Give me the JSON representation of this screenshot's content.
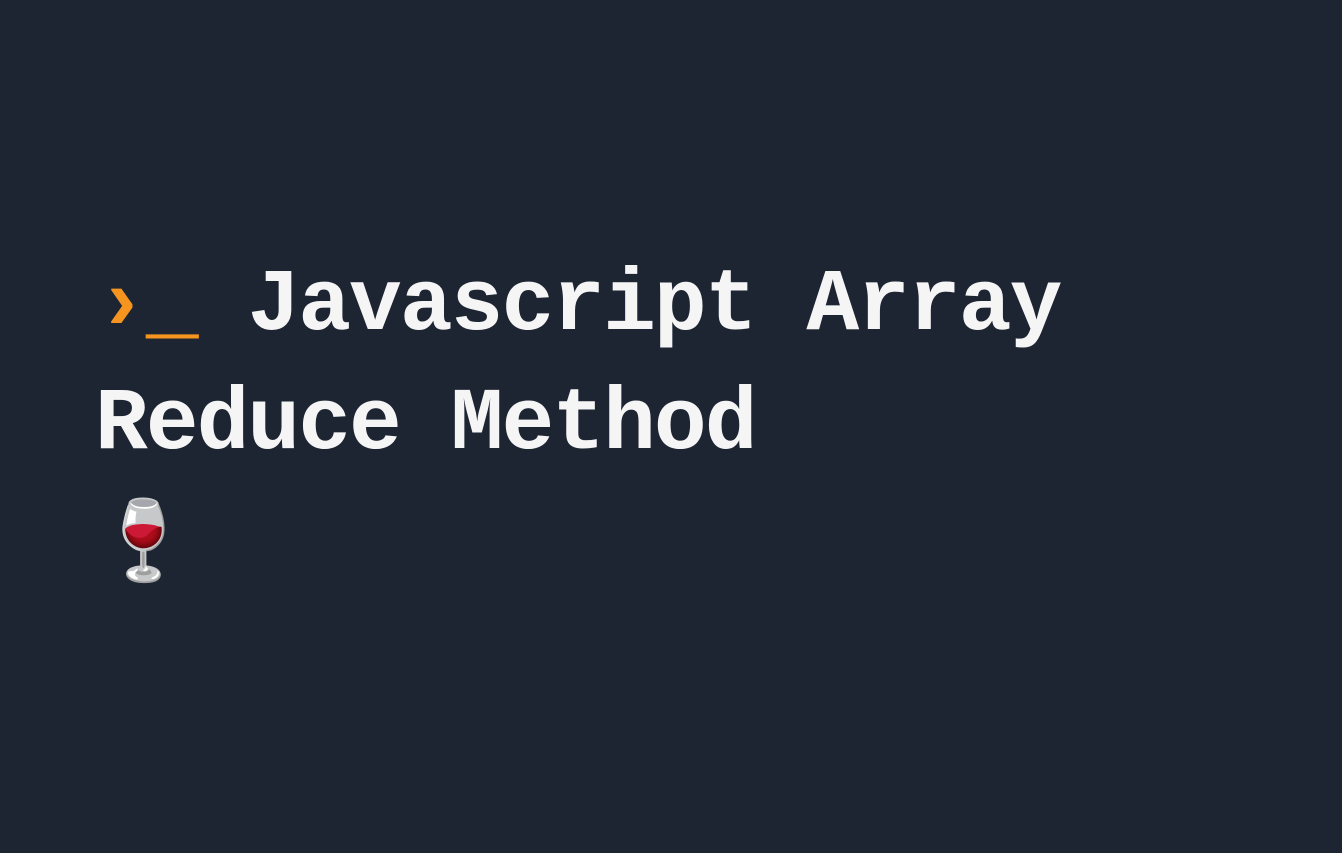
{
  "slide": {
    "prompt_caret": "›",
    "prompt_underscore": "_",
    "title": "Javascript Array Reduce Method",
    "emoji": "🍷"
  },
  "colors": {
    "background": "#1d2432",
    "accent": "#f5941e",
    "text": "#f5f5f5"
  }
}
